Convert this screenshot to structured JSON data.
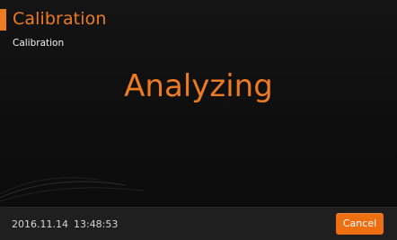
{
  "header": {
    "title": "Calibration",
    "subtitle": "Calibration"
  },
  "main": {
    "status_text": "Analyzing"
  },
  "footer": {
    "date": "2016.11.14",
    "time": "13:48:53",
    "cancel_label": "Cancel"
  },
  "colors": {
    "accent": "#ee7b22",
    "background": "#0d0d0d",
    "footer_bg": "#1f1f1f",
    "button": "#ee6f12"
  }
}
